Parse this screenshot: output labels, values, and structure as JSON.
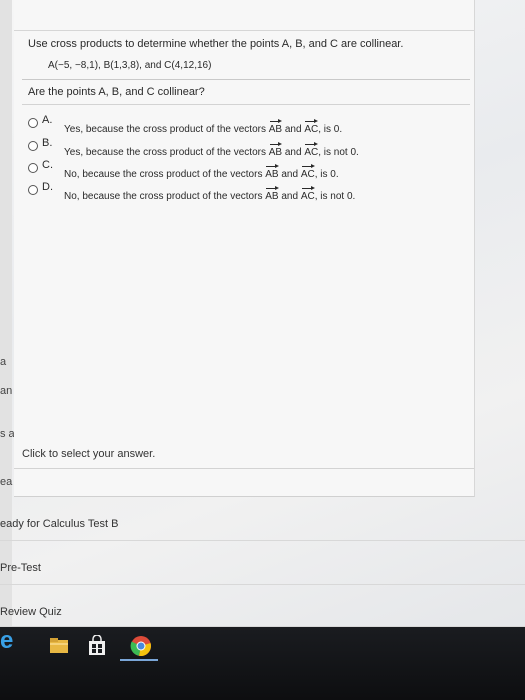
{
  "question": {
    "prompt": "Use cross products to determine whether the points A, B, and C are collinear.",
    "points": "A(−5, −8,1), B(1,3,8), and C(4,12,16)",
    "ask": "Are the points A, B, and C collinear?"
  },
  "choices": [
    {
      "letter": "A.",
      "text_pre": "Yes, because the cross product of the vectors",
      "v1": "AB",
      "mid": "and",
      "v2": "AC",
      "text_post": ", is 0."
    },
    {
      "letter": "B.",
      "text_pre": "Yes, because the cross product of the vectors",
      "v1": "AB",
      "mid": "and",
      "v2": "AC",
      "text_post": ", is not 0."
    },
    {
      "letter": "C.",
      "text_pre": "No, because the cross product of the vectors",
      "v1": "AB",
      "mid": "and",
      "v2": "AC",
      "text_post": ", is 0."
    },
    {
      "letter": "D.",
      "text_pre": "No, because the cross product of the vectors",
      "v1": "AB",
      "mid": "and",
      "v2": "AC",
      "text_post": ", is not 0."
    }
  ],
  "hint": "Click to select your answer.",
  "side_fragments": [
    "a",
    "an",
    "s a",
    "ea"
  ],
  "lower_list": [
    "eady for Calculus Test B",
    "Pre-Test",
    "Review Quiz"
  ],
  "taskbar": {
    "ie_glyph": "e",
    "icons": [
      "internet-explorer-icon",
      "file-explorer-icon",
      "store-icon",
      "chrome-icon"
    ]
  }
}
